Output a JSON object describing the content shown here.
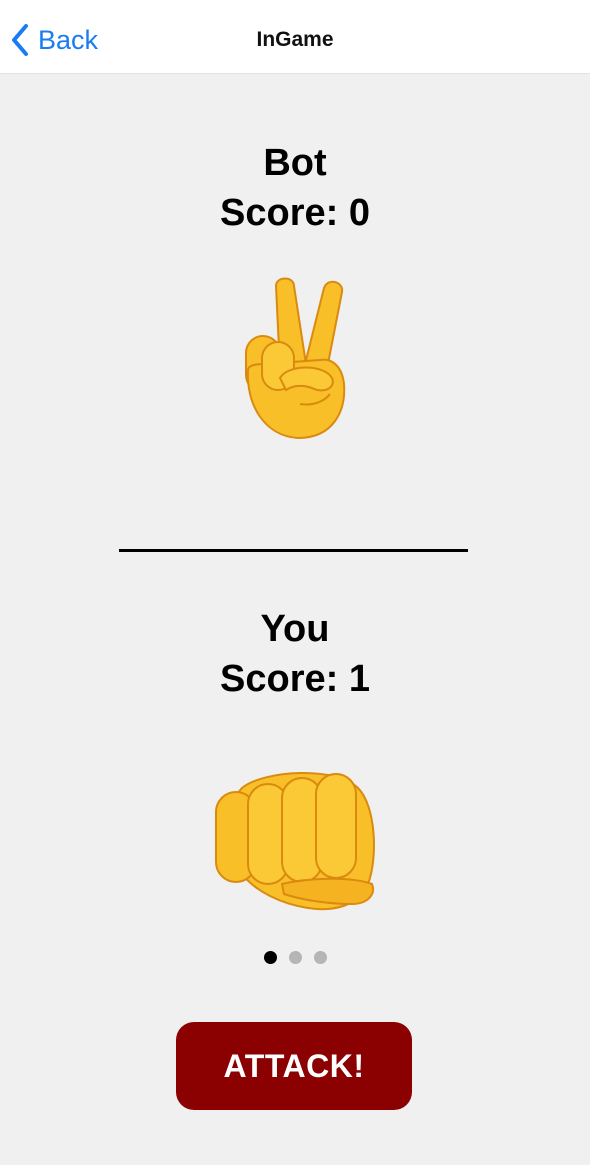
{
  "navbar": {
    "back_label": "Back",
    "title": "InGame"
  },
  "bot": {
    "name": "Bot",
    "score_label": "Score: 0",
    "hand": "victory-hand"
  },
  "player": {
    "name": "You",
    "score_label": "Score: 1",
    "hand": "fist"
  },
  "page_indicator": {
    "total": 3,
    "active_index": 0
  },
  "attack_button": {
    "label": "ATTACK!"
  },
  "colors": {
    "accent": "#1a7cf4",
    "attack_button": "#8b0000",
    "background": "#f1f0f1",
    "hand_fill": "#f9bf29"
  }
}
